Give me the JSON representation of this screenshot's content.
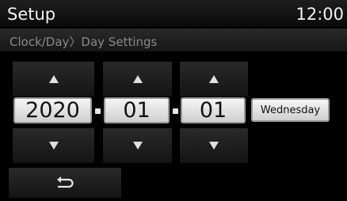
{
  "header": {
    "title": "Setup",
    "time": "12:00"
  },
  "breadcrumb": "Clock/Day〉Day Settings",
  "date": {
    "year": "2020",
    "month": "01",
    "day": "01",
    "weekday": "Wednesday"
  },
  "icons": {
    "up": "triangle-up-icon",
    "down": "triangle-down-icon",
    "back": "back-arrow-icon"
  },
  "colors": {
    "background": "#000000",
    "field": "#e8e8e8",
    "text": "#f2f2f2",
    "muted": "#8a8a8a"
  }
}
